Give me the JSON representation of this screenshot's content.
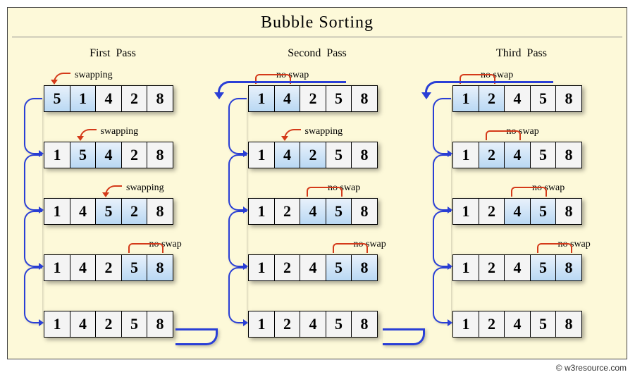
{
  "title": "Bubble  Sorting",
  "credit": "© w3resource.com",
  "swap_label": "swapping",
  "noswap_label": "no swap",
  "passes": [
    {
      "title": "First  Pass",
      "rows": [
        {
          "cells": [
            "5",
            "1",
            "4",
            "2",
            "8"
          ],
          "hl": [
            0,
            1
          ],
          "action": "swap",
          "pair": 0
        },
        {
          "cells": [
            "1",
            "5",
            "4",
            "2",
            "8"
          ],
          "hl": [
            1,
            2
          ],
          "action": "swap",
          "pair": 1
        },
        {
          "cells": [
            "1",
            "4",
            "5",
            "2",
            "8"
          ],
          "hl": [
            2,
            3
          ],
          "action": "swap",
          "pair": 2
        },
        {
          "cells": [
            "1",
            "4",
            "2",
            "5",
            "8"
          ],
          "hl": [
            3,
            4
          ],
          "action": "noswap",
          "pair": 3
        },
        {
          "cells": [
            "1",
            "4",
            "2",
            "5",
            "8"
          ],
          "hl": [],
          "action": "none"
        }
      ]
    },
    {
      "title": "Second  Pass",
      "rows": [
        {
          "cells": [
            "1",
            "4",
            "2",
            "5",
            "8"
          ],
          "hl": [
            0,
            1
          ],
          "action": "noswap",
          "pair": 0
        },
        {
          "cells": [
            "1",
            "4",
            "2",
            "5",
            "8"
          ],
          "hl": [
            1,
            2
          ],
          "action": "swap",
          "pair": 1
        },
        {
          "cells": [
            "1",
            "2",
            "4",
            "5",
            "8"
          ],
          "hl": [
            2,
            3
          ],
          "action": "noswap",
          "pair": 2
        },
        {
          "cells": [
            "1",
            "2",
            "4",
            "5",
            "8"
          ],
          "hl": [
            3,
            4
          ],
          "action": "noswap",
          "pair": 3
        },
        {
          "cells": [
            "1",
            "2",
            "4",
            "5",
            "8"
          ],
          "hl": [],
          "action": "none"
        }
      ]
    },
    {
      "title": "Third  Pass",
      "rows": [
        {
          "cells": [
            "1",
            "2",
            "4",
            "5",
            "8"
          ],
          "hl": [
            0,
            1
          ],
          "action": "noswap",
          "pair": 0
        },
        {
          "cells": [
            "1",
            "2",
            "4",
            "5",
            "8"
          ],
          "hl": [
            1,
            2
          ],
          "action": "noswap",
          "pair": 1
        },
        {
          "cells": [
            "1",
            "2",
            "4",
            "5",
            "8"
          ],
          "hl": [
            2,
            3
          ],
          "action": "noswap",
          "pair": 2
        },
        {
          "cells": [
            "1",
            "2",
            "4",
            "5",
            "8"
          ],
          "hl": [
            3,
            4
          ],
          "action": "noswap",
          "pair": 3
        },
        {
          "cells": [
            "1",
            "2",
            "4",
            "5",
            "8"
          ],
          "hl": [],
          "action": "none"
        }
      ]
    }
  ]
}
